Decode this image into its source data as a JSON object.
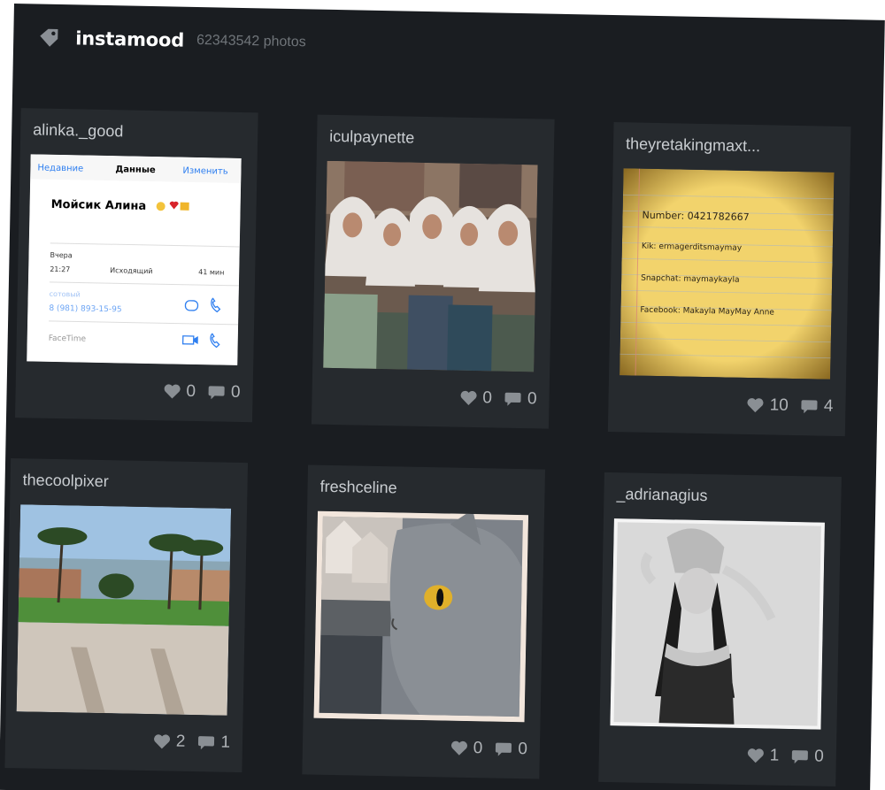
{
  "header": {
    "brand": "instamood",
    "count": "62343542 photos",
    "icon": "tag-icon"
  },
  "colors": {
    "board": "#1a1d21",
    "card": "#262a2e",
    "username": "#c9cdd1",
    "stats": "#b0b4b8"
  },
  "cards": [
    {
      "username": "alinka._good",
      "likes": "0",
      "comments": "0",
      "photo": {
        "back_label": "Недавние",
        "title": "Данные",
        "edit_label": "Изменить",
        "contact_name": "Мойсик Алина",
        "section_label": "Вчера",
        "call_time": "21:27",
        "call_type": "Исходящий",
        "call_duration": "41 мин",
        "phone_label": "сотовый",
        "phone_number": "8 (981) 893-15-95",
        "facetime_label": "FaceTime"
      }
    },
    {
      "username": "iculpaynette",
      "likes": "0",
      "comments": "0"
    },
    {
      "username": "theyretakingmaxt...",
      "likes": "10",
      "comments": "4",
      "photo": {
        "line1": "Number: 0421782667",
        "line2": "Kik: ermagerditsmaymay",
        "line3": "Snapchat: maymaykayla",
        "line4": "Facebook: Makayla MayMay Anne"
      }
    },
    {
      "username": "thecoolpixer",
      "likes": "2",
      "comments": "1"
    },
    {
      "username": "freshceline",
      "likes": "0",
      "comments": "0"
    },
    {
      "username": "_adrianagius",
      "likes": "1",
      "comments": "0"
    }
  ]
}
